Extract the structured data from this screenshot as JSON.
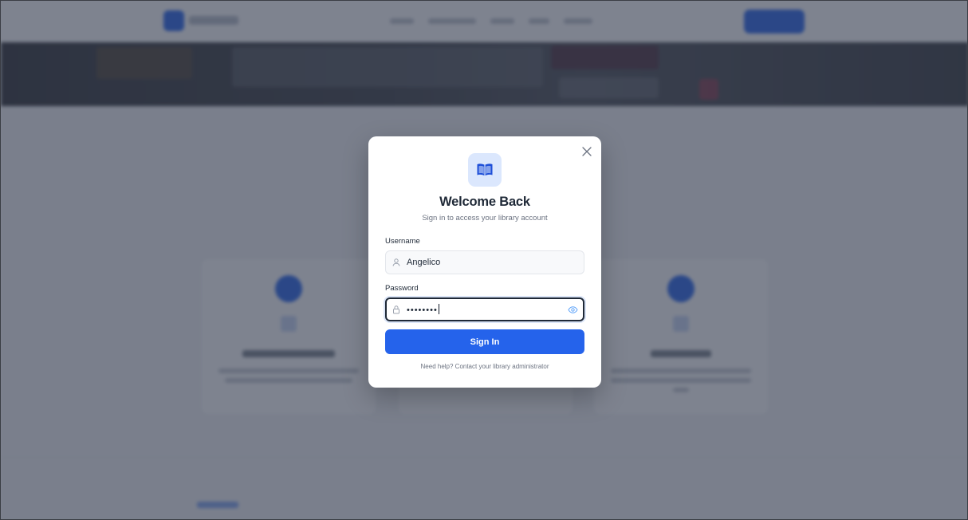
{
  "modal": {
    "title": "Welcome Back",
    "subtitle": "Sign in to access your library account",
    "logo_icon": "book-open-icon",
    "close_icon": "close-icon",
    "username": {
      "label": "Username",
      "value": "Angelico",
      "icon": "user-icon"
    },
    "password": {
      "label": "Password",
      "value": "••••••••",
      "icon": "lock-icon",
      "toggle_icon": "eye-icon"
    },
    "submit_label": "Sign In",
    "help_text": "Need help? Contact your library administrator"
  },
  "colors": {
    "primary": "#2563eb",
    "logo_bg": "#dbe7fd",
    "title": "#1f2937",
    "muted": "#6b7280",
    "overlay": "rgba(47,55,75,0.62)"
  }
}
